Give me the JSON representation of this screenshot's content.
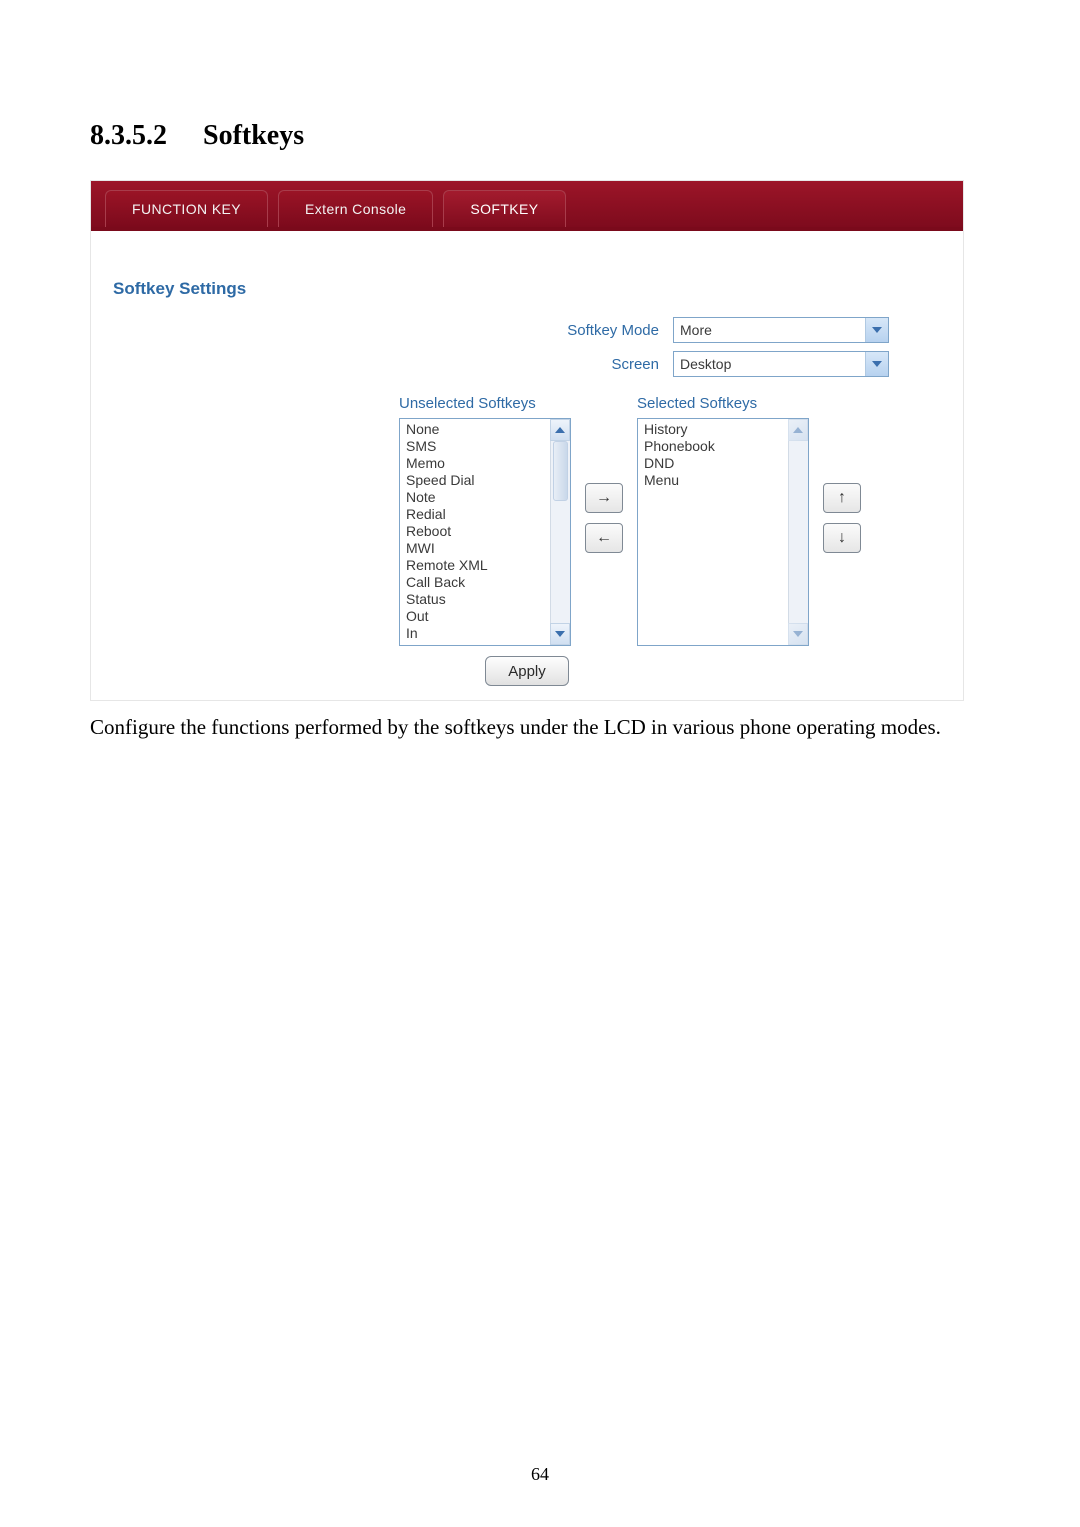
{
  "heading": {
    "number": "8.3.5.2",
    "title": "Softkeys"
  },
  "tabs": {
    "function_key": "FUNCTION KEY",
    "extern_console": "Extern Console",
    "softkey": "SOFTKEY"
  },
  "section_title": "Softkey Settings",
  "labels": {
    "softkey_mode": "Softkey Mode",
    "screen": "Screen",
    "unselected": "Unselected Softkeys",
    "selected": "Selected Softkeys"
  },
  "selects": {
    "softkey_mode_value": "More",
    "screen_value": "Desktop"
  },
  "unselected_items": [
    "None",
    "SMS",
    "Memo",
    "Speed Dial",
    "Note",
    "Redial",
    "Reboot",
    "MWI",
    "Remote XML",
    "Call Back",
    "Status",
    "Out",
    "In"
  ],
  "selected_items": [
    "History",
    "Phonebook",
    "DND",
    "Menu"
  ],
  "buttons": {
    "move_right": "→",
    "move_left": "←",
    "move_up": "↑",
    "move_down": "↓",
    "apply": "Apply"
  },
  "body_text": "Configure the functions performed by the softkeys under the LCD in various phone operating modes.",
  "page_number": "64"
}
